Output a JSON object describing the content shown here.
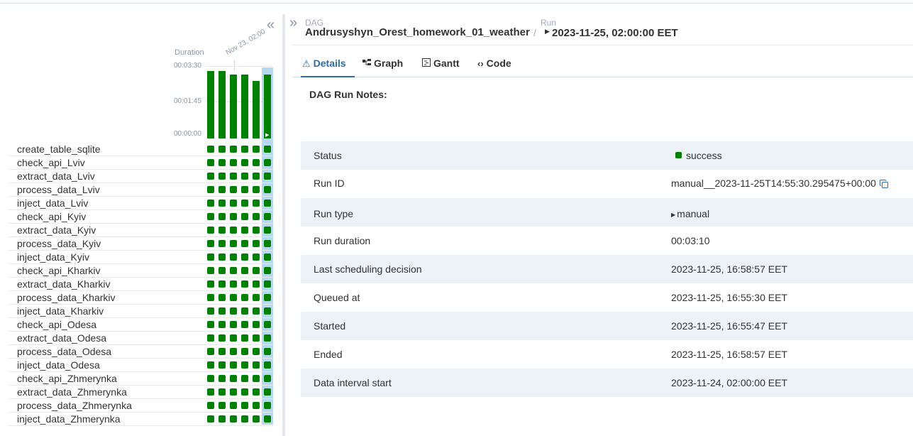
{
  "grid": {
    "duration_label": "Duration",
    "date_label": "Nov 23, 02:00",
    "yticks": [
      "00:03:30",
      "00:01:45",
      "00:00:00"
    ],
    "run_durations_sec": [
      200,
      199,
      190,
      188,
      170,
      190
    ],
    "tasks": [
      "create_table_sqlite",
      "check_api_Lviv",
      "extract_data_Lviv",
      "process_data_Lviv",
      "inject_data_Lviv",
      "check_api_Kyiv",
      "extract_data_Kyiv",
      "process_data_Kyiv",
      "inject_data_Kyiv",
      "check_api_Kharkiv",
      "extract_data_Kharkiv",
      "process_data_Kharkiv",
      "inject_data_Kharkiv",
      "check_api_Odesa",
      "extract_data_Odesa",
      "process_data_Odesa",
      "inject_data_Odesa",
      "check_api_Zhmerynka",
      "extract_data_Zhmerynka",
      "process_data_Zhmerynka",
      "inject_data_Zhmerynka"
    ],
    "run_count": 6,
    "status_color": "#008000",
    "selected_color": "#b7d9f0"
  },
  "header": {
    "dag_caption": "DAG",
    "dag_name": "Andrusyshyn_Orest_homework_01_weather",
    "separator": "/",
    "run_caption": "Run",
    "run_name": "2023-11-25, 02:00:00 EET"
  },
  "tabs": [
    {
      "label": "Details",
      "icon": "warning-triangle-icon"
    },
    {
      "label": "Graph",
      "icon": "graph-icon"
    },
    {
      "label": "Gantt",
      "icon": "gantt-icon"
    },
    {
      "label": "Code",
      "icon": "code-icon"
    }
  ],
  "notes_title": "DAG Run Notes:",
  "details": [
    {
      "label": "Status",
      "value": "success"
    },
    {
      "label": "Run ID",
      "value": "manual__2023-11-25T14:55:30.295475+00:00"
    },
    {
      "label": "Run type",
      "value": "manual"
    },
    {
      "label": "Run duration",
      "value": "00:03:10"
    },
    {
      "label": "Last scheduling decision",
      "value": "2023-11-25, 16:58:57 EET"
    },
    {
      "label": "Queued at",
      "value": "2023-11-25, 16:55:30 EET"
    },
    {
      "label": "Started",
      "value": "2023-11-25, 16:55:47 EET"
    },
    {
      "label": "Ended",
      "value": "2023-11-25, 16:58:57 EET"
    },
    {
      "label": "Data interval start",
      "value": "2023-11-24, 02:00:00 EET"
    }
  ]
}
